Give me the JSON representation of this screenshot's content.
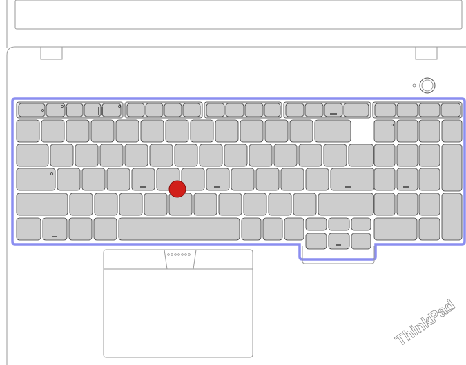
{
  "brand": {
    "logo_text": "ThinkPad"
  },
  "colors": {
    "background": "#ffffff",
    "key_fill": "#cdcdcd",
    "key_stroke": "#3a3a3a",
    "keyboard_highlight": "#8b8ef0",
    "trackpoint": "#d11f1a",
    "outline": "#9a9a9a"
  },
  "keyboard": {
    "highlighted": true,
    "trackpoint_present": true
  },
  "icons": [
    "power-button-icon",
    "trackpoint-icon",
    "fingerprint-reader-icon",
    "camera-shutter-icon",
    "thinkpad-logo-icon"
  ]
}
